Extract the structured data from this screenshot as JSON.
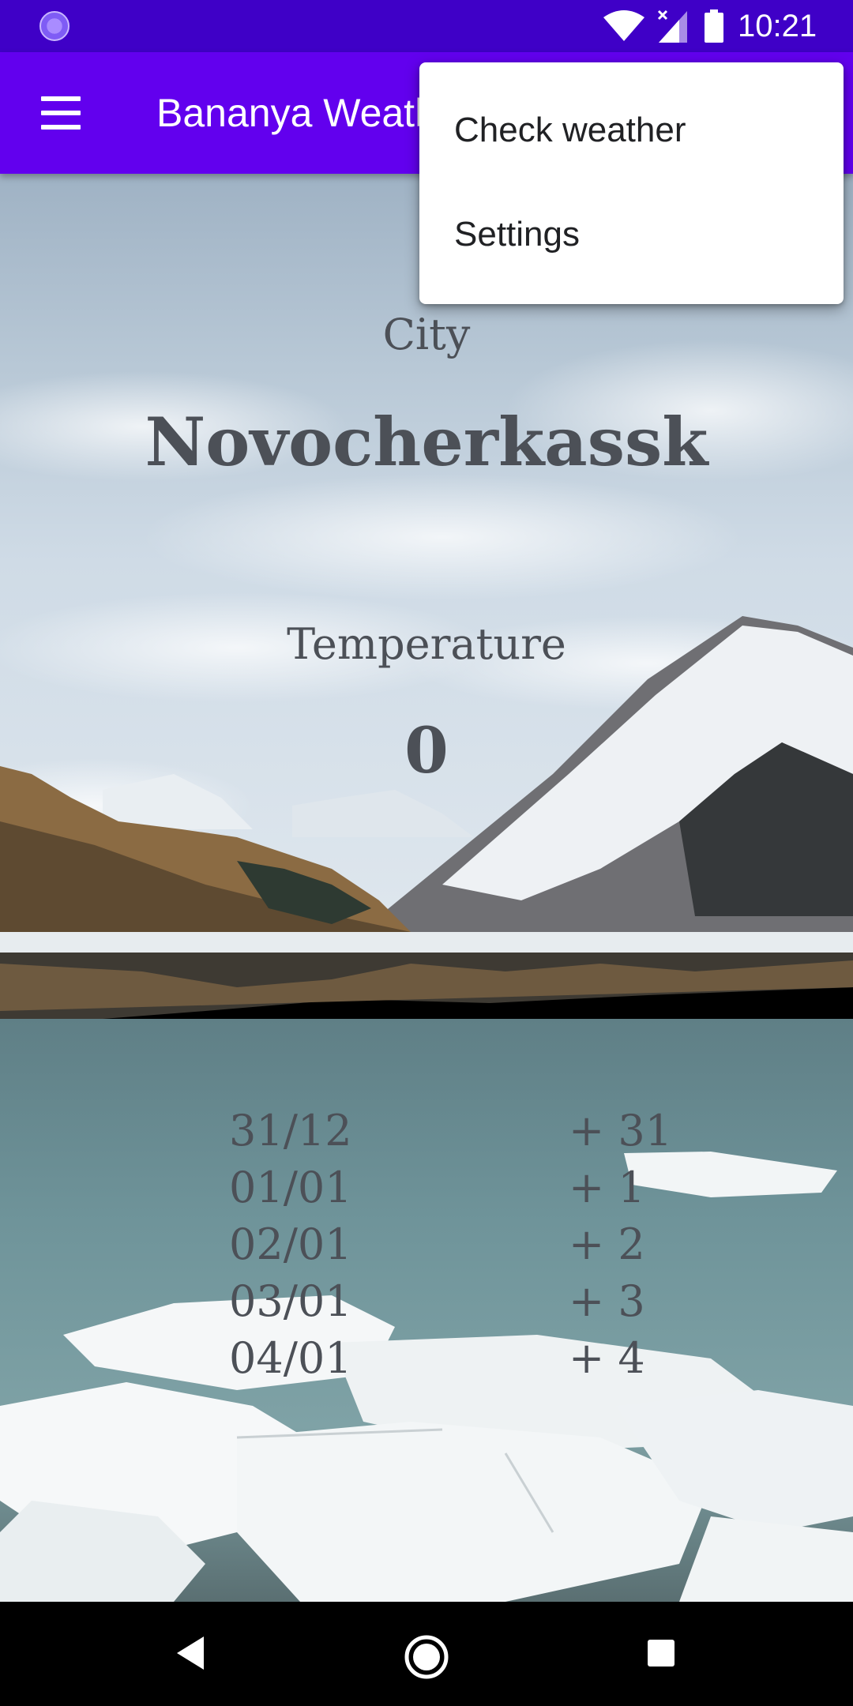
{
  "status_bar": {
    "time": "10:21",
    "icons": [
      "app-notification-icon",
      "wifi-icon",
      "signal-icon",
      "battery-icon"
    ]
  },
  "app_bar": {
    "title": "Bananya Weather",
    "menu_icon": "hamburger-menu-icon",
    "color": "#6200ee"
  },
  "overflow_menu": {
    "items": [
      {
        "label": "Check weather"
      },
      {
        "label": "Settings"
      }
    ]
  },
  "main": {
    "city_label": "City",
    "city_name": "Novocherkassk",
    "temperature_label": "Temperature",
    "temperature_value": "0",
    "forecast": [
      {
        "date": "31/12",
        "temp": "+ 31"
      },
      {
        "date": "01/01",
        "temp": "+ 1"
      },
      {
        "date": "02/01",
        "temp": "+ 2"
      },
      {
        "date": "03/01",
        "temp": "+ 3"
      },
      {
        "date": "04/01",
        "temp": "+ 4"
      }
    ]
  },
  "nav_bar": {
    "icons": [
      "back-icon",
      "home-icon",
      "recents-icon"
    ]
  },
  "colors": {
    "status_bar": "#3f00c7",
    "app_bar": "#6200ee",
    "text": "#4c5057"
  }
}
